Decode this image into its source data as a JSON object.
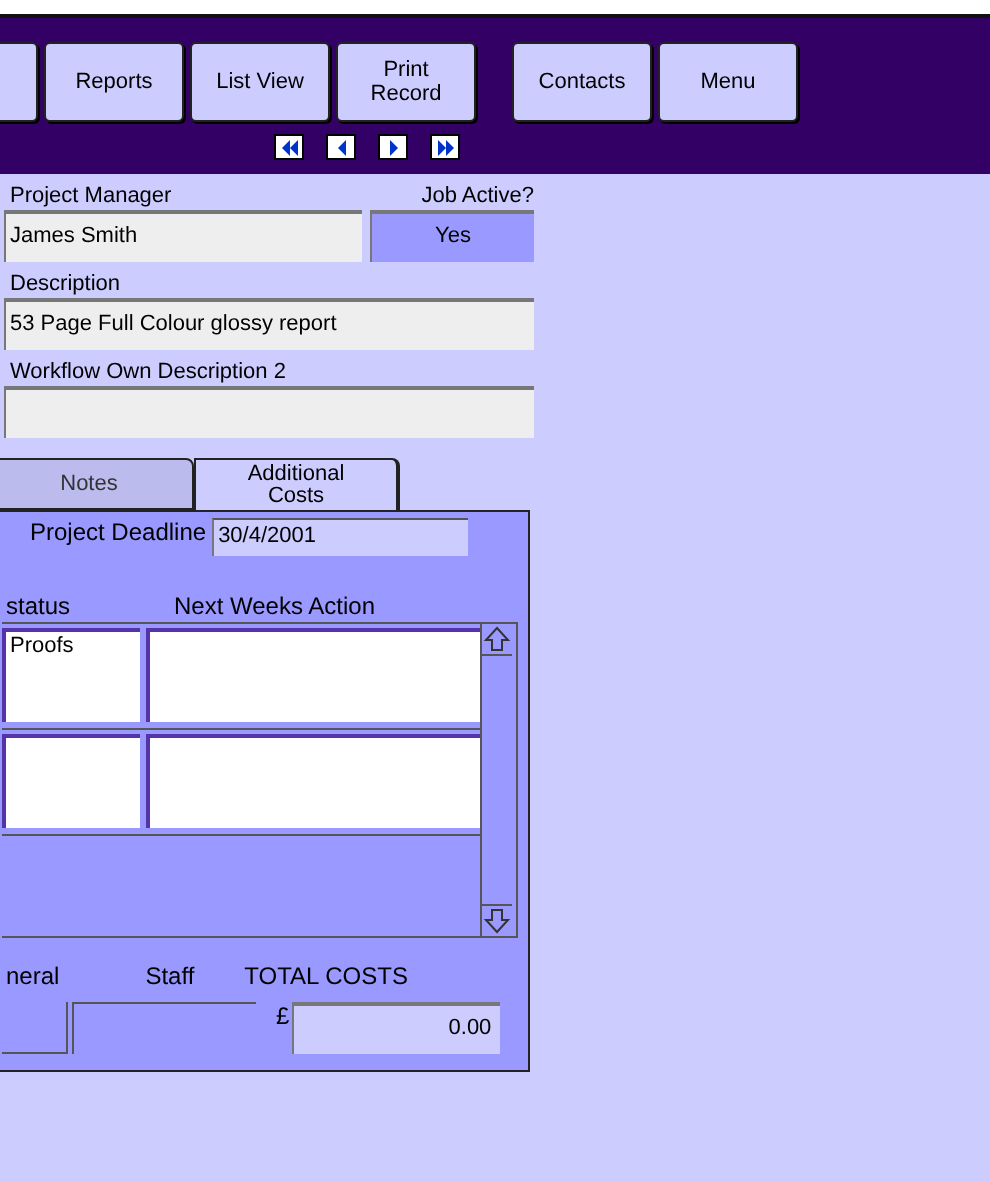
{
  "toolbar": {
    "buttons": [
      {
        "label": "Reports"
      },
      {
        "label": "List View"
      },
      {
        "label": "Print Record"
      },
      {
        "label": "Contacts"
      },
      {
        "label": "Menu"
      }
    ]
  },
  "form": {
    "project_manager": {
      "label": "Project Manager",
      "value": "James Smith"
    },
    "job_active": {
      "label": "Job Active?",
      "value": "Yes"
    },
    "description": {
      "label": "Description",
      "value": "53 Page Full Colour glossy report"
    },
    "workflow_description": {
      "label": "Workflow Own Description 2"
    }
  },
  "tabs": [
    {
      "label": "Notes",
      "selected": false
    },
    {
      "label": "Additional Costs",
      "selected": true
    }
  ],
  "panel": {
    "deadline": {
      "label": "Project Deadline",
      "value": "30/4/2001"
    },
    "columns": [
      "status",
      "Next Weeks Action"
    ],
    "rows": [
      {
        "status": "Proofs"
      },
      {}
    ],
    "costs": {
      "column_1": "neral",
      "staff": "Staff",
      "total_label": "TOTAL COSTS",
      "currency": "£",
      "total": "0.00"
    }
  }
}
